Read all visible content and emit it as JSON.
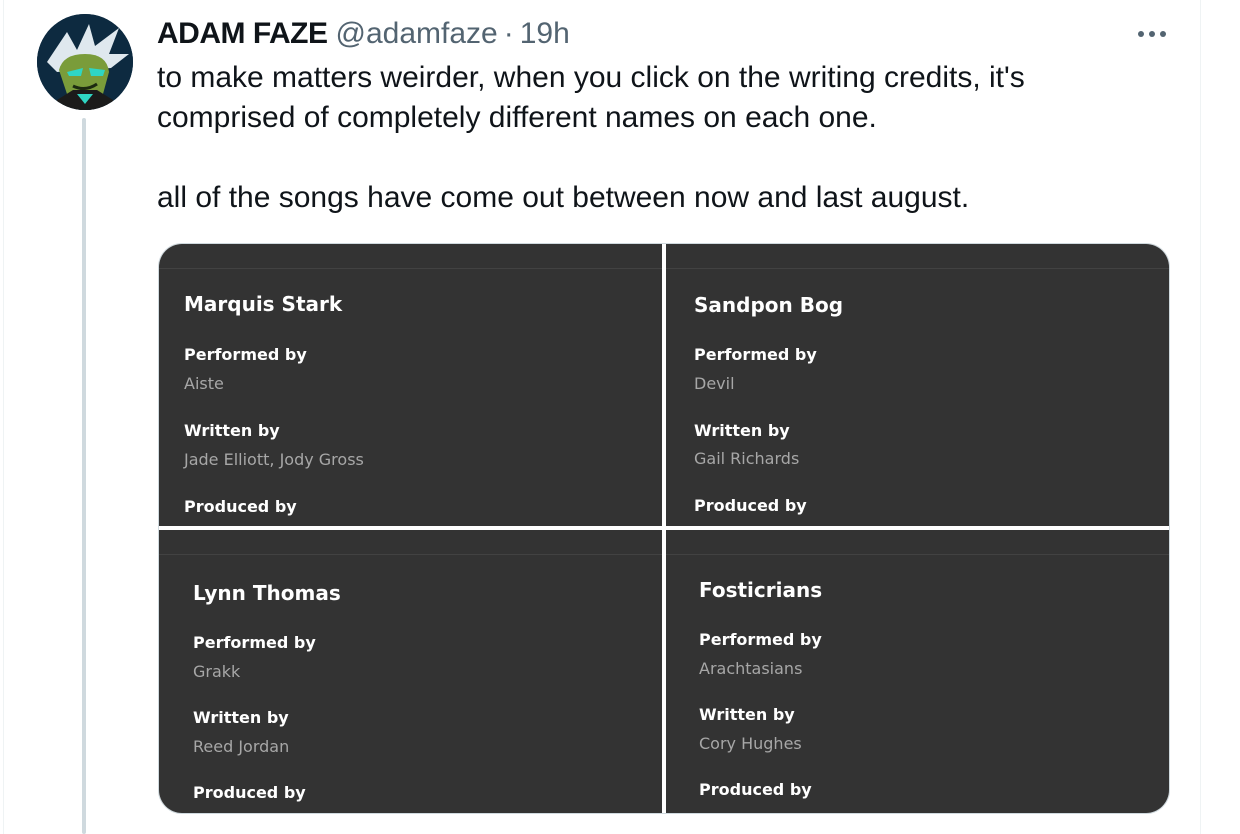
{
  "tweet": {
    "author_name": "ADAM FAZE",
    "handle": "@adamfaze",
    "separator": "·",
    "time": "19h",
    "more_icon": "more-horizontal-icon",
    "text_line1": "to make matters weirder, when you click on the writing credits, it's",
    "text_line2": "comprised of completely different names on each one.",
    "text_line3": "all of the songs have come out between now and last august."
  },
  "media": {
    "panes": [
      {
        "song": "Marquis Stark",
        "performed_label": "Performed by",
        "performed": "Aiste",
        "written_label": "Written by",
        "written": "Jade Elliott, Jody Gross",
        "produced_label": "Produced by"
      },
      {
        "song": "Sandpon Bog",
        "performed_label": "Performed by",
        "performed": "Devil",
        "written_label": "Written by",
        "written": "Gail Richards",
        "produced_label": "Produced by"
      },
      {
        "song": "Lynn Thomas",
        "performed_label": "Performed by",
        "performed": "Grakk",
        "written_label": "Written by",
        "written": "Reed Jordan",
        "produced_label": "Produced by"
      },
      {
        "song": "Fosticrians",
        "performed_label": "Performed by",
        "performed": "Arachtasians",
        "written_label": "Written by",
        "written": "Cory Hughes",
        "produced_label": "Produced by"
      }
    ]
  },
  "colors": {
    "text": "#0f1419",
    "secondary": "#536471",
    "thread_line": "#cfd9de",
    "pane_bg": "#333333",
    "credit_muted": "#a7a7a7"
  }
}
